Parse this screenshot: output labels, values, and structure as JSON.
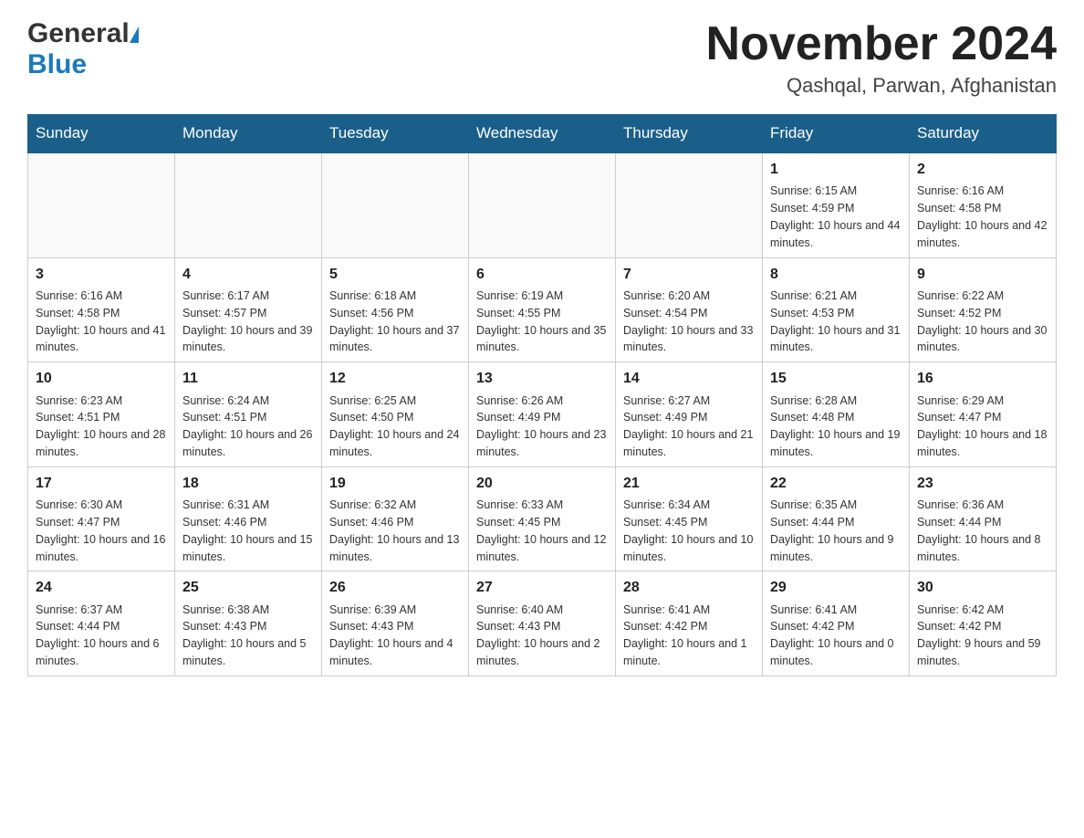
{
  "header": {
    "logo_general": "General",
    "logo_blue": "Blue",
    "title": "November 2024",
    "subtitle": "Qashqal, Parwan, Afghanistan"
  },
  "calendar": {
    "weekdays": [
      "Sunday",
      "Monday",
      "Tuesday",
      "Wednesday",
      "Thursday",
      "Friday",
      "Saturday"
    ],
    "weeks": [
      [
        {
          "day": "",
          "info": ""
        },
        {
          "day": "",
          "info": ""
        },
        {
          "day": "",
          "info": ""
        },
        {
          "day": "",
          "info": ""
        },
        {
          "day": "",
          "info": ""
        },
        {
          "day": "1",
          "info": "Sunrise: 6:15 AM\nSunset: 4:59 PM\nDaylight: 10 hours and 44 minutes."
        },
        {
          "day": "2",
          "info": "Sunrise: 6:16 AM\nSunset: 4:58 PM\nDaylight: 10 hours and 42 minutes."
        }
      ],
      [
        {
          "day": "3",
          "info": "Sunrise: 6:16 AM\nSunset: 4:58 PM\nDaylight: 10 hours and 41 minutes."
        },
        {
          "day": "4",
          "info": "Sunrise: 6:17 AM\nSunset: 4:57 PM\nDaylight: 10 hours and 39 minutes."
        },
        {
          "day": "5",
          "info": "Sunrise: 6:18 AM\nSunset: 4:56 PM\nDaylight: 10 hours and 37 minutes."
        },
        {
          "day": "6",
          "info": "Sunrise: 6:19 AM\nSunset: 4:55 PM\nDaylight: 10 hours and 35 minutes."
        },
        {
          "day": "7",
          "info": "Sunrise: 6:20 AM\nSunset: 4:54 PM\nDaylight: 10 hours and 33 minutes."
        },
        {
          "day": "8",
          "info": "Sunrise: 6:21 AM\nSunset: 4:53 PM\nDaylight: 10 hours and 31 minutes."
        },
        {
          "day": "9",
          "info": "Sunrise: 6:22 AM\nSunset: 4:52 PM\nDaylight: 10 hours and 30 minutes."
        }
      ],
      [
        {
          "day": "10",
          "info": "Sunrise: 6:23 AM\nSunset: 4:51 PM\nDaylight: 10 hours and 28 minutes."
        },
        {
          "day": "11",
          "info": "Sunrise: 6:24 AM\nSunset: 4:51 PM\nDaylight: 10 hours and 26 minutes."
        },
        {
          "day": "12",
          "info": "Sunrise: 6:25 AM\nSunset: 4:50 PM\nDaylight: 10 hours and 24 minutes."
        },
        {
          "day": "13",
          "info": "Sunrise: 6:26 AM\nSunset: 4:49 PM\nDaylight: 10 hours and 23 minutes."
        },
        {
          "day": "14",
          "info": "Sunrise: 6:27 AM\nSunset: 4:49 PM\nDaylight: 10 hours and 21 minutes."
        },
        {
          "day": "15",
          "info": "Sunrise: 6:28 AM\nSunset: 4:48 PM\nDaylight: 10 hours and 19 minutes."
        },
        {
          "day": "16",
          "info": "Sunrise: 6:29 AM\nSunset: 4:47 PM\nDaylight: 10 hours and 18 minutes."
        }
      ],
      [
        {
          "day": "17",
          "info": "Sunrise: 6:30 AM\nSunset: 4:47 PM\nDaylight: 10 hours and 16 minutes."
        },
        {
          "day": "18",
          "info": "Sunrise: 6:31 AM\nSunset: 4:46 PM\nDaylight: 10 hours and 15 minutes."
        },
        {
          "day": "19",
          "info": "Sunrise: 6:32 AM\nSunset: 4:46 PM\nDaylight: 10 hours and 13 minutes."
        },
        {
          "day": "20",
          "info": "Sunrise: 6:33 AM\nSunset: 4:45 PM\nDaylight: 10 hours and 12 minutes."
        },
        {
          "day": "21",
          "info": "Sunrise: 6:34 AM\nSunset: 4:45 PM\nDaylight: 10 hours and 10 minutes."
        },
        {
          "day": "22",
          "info": "Sunrise: 6:35 AM\nSunset: 4:44 PM\nDaylight: 10 hours and 9 minutes."
        },
        {
          "day": "23",
          "info": "Sunrise: 6:36 AM\nSunset: 4:44 PM\nDaylight: 10 hours and 8 minutes."
        }
      ],
      [
        {
          "day": "24",
          "info": "Sunrise: 6:37 AM\nSunset: 4:44 PM\nDaylight: 10 hours and 6 minutes."
        },
        {
          "day": "25",
          "info": "Sunrise: 6:38 AM\nSunset: 4:43 PM\nDaylight: 10 hours and 5 minutes."
        },
        {
          "day": "26",
          "info": "Sunrise: 6:39 AM\nSunset: 4:43 PM\nDaylight: 10 hours and 4 minutes."
        },
        {
          "day": "27",
          "info": "Sunrise: 6:40 AM\nSunset: 4:43 PM\nDaylight: 10 hours and 2 minutes."
        },
        {
          "day": "28",
          "info": "Sunrise: 6:41 AM\nSunset: 4:42 PM\nDaylight: 10 hours and 1 minute."
        },
        {
          "day": "29",
          "info": "Sunrise: 6:41 AM\nSunset: 4:42 PM\nDaylight: 10 hours and 0 minutes."
        },
        {
          "day": "30",
          "info": "Sunrise: 6:42 AM\nSunset: 4:42 PM\nDaylight: 9 hours and 59 minutes."
        }
      ]
    ]
  }
}
